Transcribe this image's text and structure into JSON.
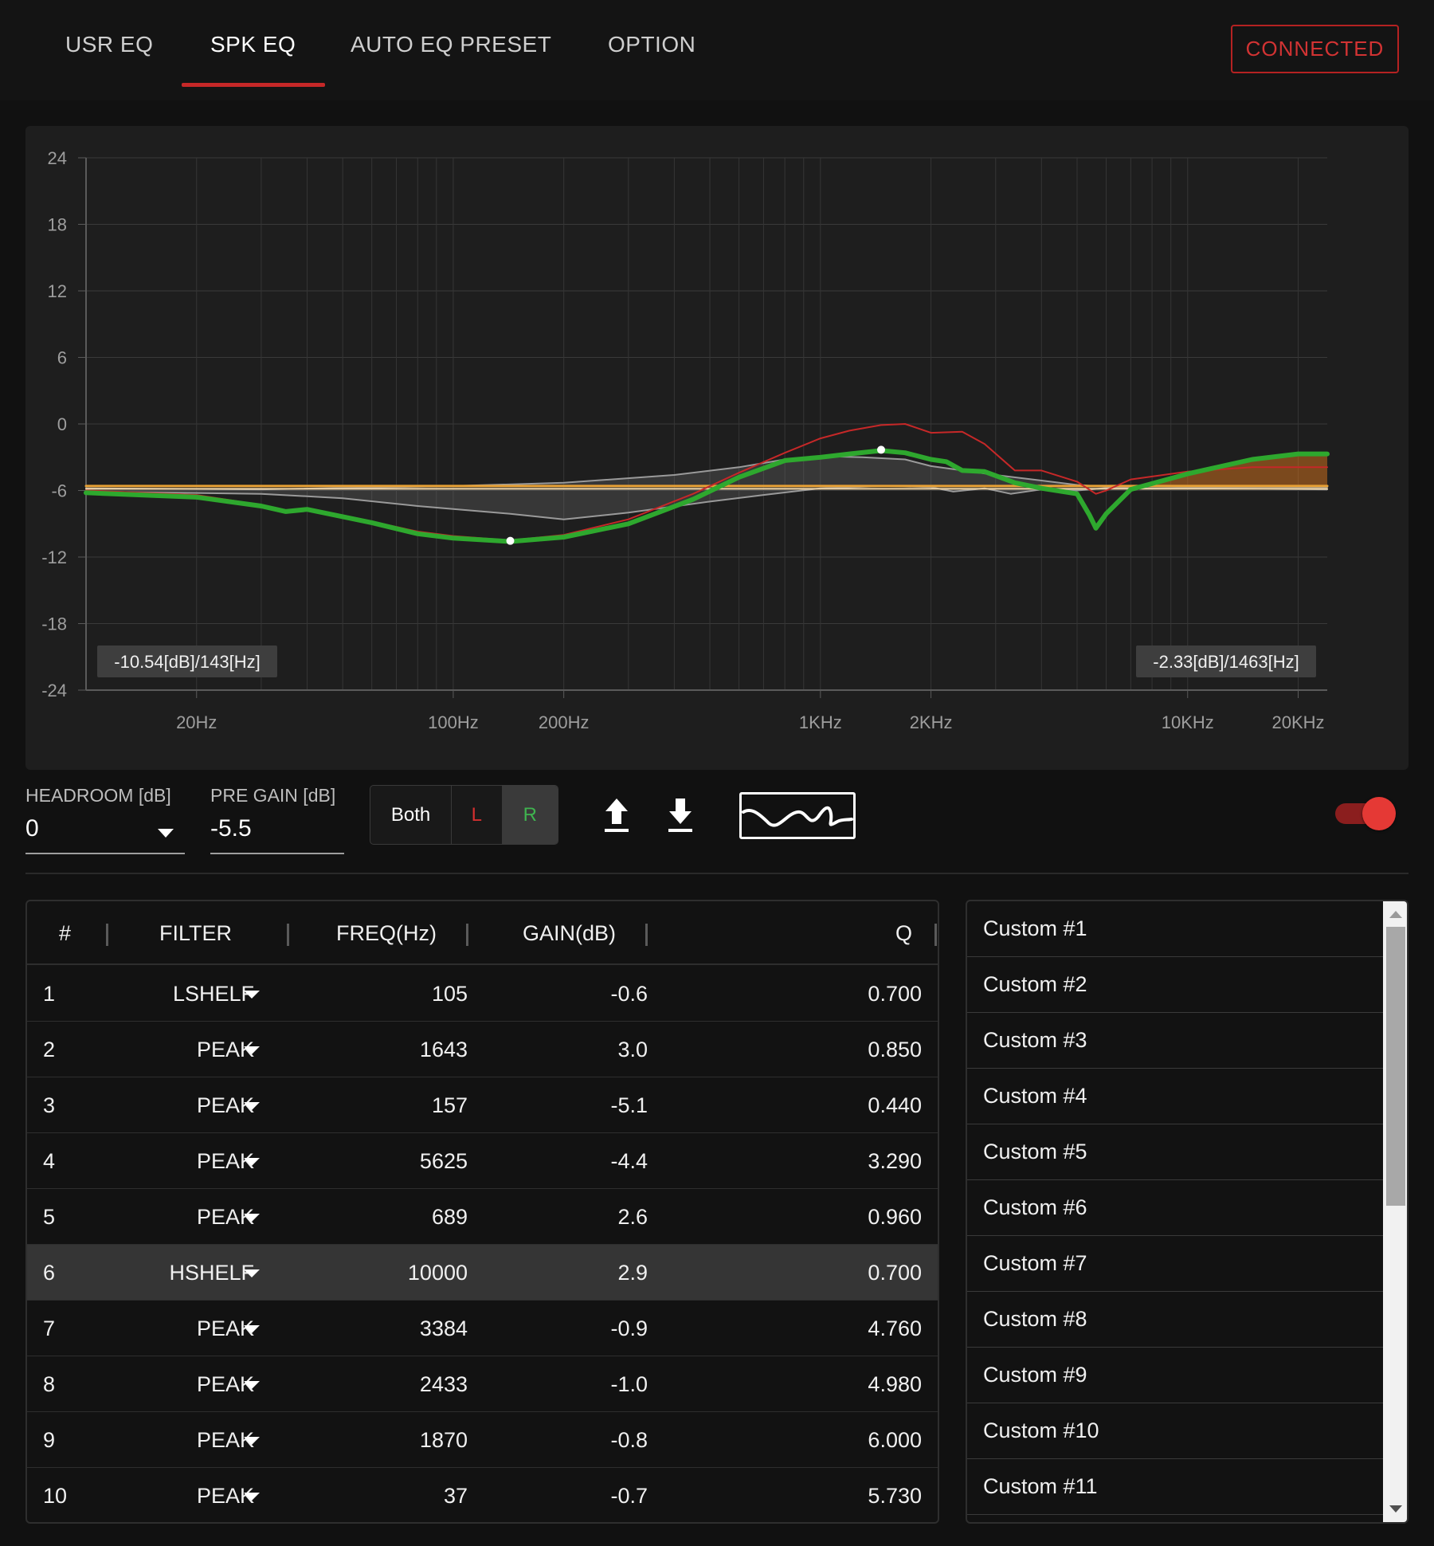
{
  "tabs": [
    {
      "label": "USR EQ",
      "active": false
    },
    {
      "label": "SPK EQ",
      "active": true
    },
    {
      "label": "AUTO EQ PRESET",
      "active": false
    },
    {
      "label": "OPTION",
      "active": false
    }
  ],
  "status": {
    "label": "CONNECTED",
    "color": "#d23333"
  },
  "chart_data": {
    "type": "line",
    "xscale": "log",
    "xlim": [
      10,
      24000
    ],
    "ylim": [
      -24,
      24
    ],
    "y_ticks": [
      "24",
      "18",
      "12",
      "6",
      "0",
      "-6",
      "-12",
      "-18",
      "-24"
    ],
    "x_ticks": [
      {
        "label": "20Hz",
        "value": 20
      },
      {
        "label": "100Hz",
        "value": 100
      },
      {
        "label": "200Hz",
        "value": 200
      },
      {
        "label": "1KHz",
        "value": 1000
      },
      {
        "label": "2KHz",
        "value": 2000
      },
      {
        "label": "10KHz",
        "value": 10000
      },
      {
        "label": "20KHz",
        "value": 20000
      }
    ],
    "grid": true,
    "series": [
      {
        "color": "#2ea82e",
        "points": [
          [
            10,
            -6.2
          ],
          [
            20,
            -6.6
          ],
          [
            30,
            -7.4
          ],
          [
            35,
            -7.9
          ],
          [
            40,
            -7.7
          ],
          [
            60,
            -8.9
          ],
          [
            80,
            -9.9
          ],
          [
            100,
            -10.3
          ],
          [
            143,
            -10.6
          ],
          [
            200,
            -10.2
          ],
          [
            300,
            -9
          ],
          [
            450,
            -6.8
          ],
          [
            600,
            -4.8
          ],
          [
            800,
            -3.3
          ],
          [
            1000,
            -3
          ],
          [
            1200,
            -2.7
          ],
          [
            1463,
            -2.4
          ],
          [
            1700,
            -2.6
          ],
          [
            2000,
            -3.2
          ],
          [
            2200,
            -3.4
          ],
          [
            2433,
            -4.2
          ],
          [
            2800,
            -4.3
          ],
          [
            3384,
            -5.3
          ],
          [
            4000,
            -5.8
          ],
          [
            5000,
            -6.3
          ],
          [
            5400,
            -8.2
          ],
          [
            5625,
            -9.4
          ],
          [
            6000,
            -8.1
          ],
          [
            7000,
            -5.9
          ],
          [
            10000,
            -4.5
          ],
          [
            15000,
            -3.2
          ],
          [
            20000,
            -2.7
          ],
          [
            24000,
            -2.7
          ]
        ]
      },
      {
        "color": "#c62828",
        "points": [
          [
            10,
            -6
          ],
          [
            20,
            -6.4
          ],
          [
            30,
            -7.3
          ],
          [
            35,
            -7.8
          ],
          [
            40,
            -7.6
          ],
          [
            60,
            -8.8
          ],
          [
            80,
            -9.7
          ],
          [
            100,
            -10.1
          ],
          [
            143,
            -10.5
          ],
          [
            200,
            -10
          ],
          [
            300,
            -8.6
          ],
          [
            450,
            -6.3
          ],
          [
            600,
            -4.4
          ],
          [
            800,
            -2.6
          ],
          [
            1000,
            -1.3
          ],
          [
            1200,
            -0.6
          ],
          [
            1463,
            -0.1
          ],
          [
            1700,
            0
          ],
          [
            2000,
            -0.8
          ],
          [
            2433,
            -0.7
          ],
          [
            2800,
            -1.8
          ],
          [
            3384,
            -4.2
          ],
          [
            4000,
            -4.2
          ],
          [
            5000,
            -5.2
          ],
          [
            5625,
            -6.3
          ],
          [
            6000,
            -6
          ],
          [
            7000,
            -5
          ],
          [
            10000,
            -4.3
          ],
          [
            15000,
            -3.9
          ],
          [
            20000,
            -3.9
          ],
          [
            24000,
            -3.9
          ]
        ]
      },
      {
        "color": "#9a9a9a",
        "points": [
          [
            10,
            -5.8
          ],
          [
            30,
            -5.9
          ],
          [
            100,
            -5.6
          ],
          [
            200,
            -5.3
          ],
          [
            400,
            -4.6
          ],
          [
            600,
            -3.9
          ],
          [
            800,
            -3.2
          ],
          [
            1000,
            -2.9
          ],
          [
            1300,
            -3
          ],
          [
            1700,
            -3.2
          ],
          [
            2000,
            -3.8
          ],
          [
            3000,
            -4.6
          ],
          [
            4000,
            -5.1
          ],
          [
            5000,
            -5.5
          ],
          [
            7000,
            -5.8
          ],
          [
            10000,
            -5.8
          ],
          [
            24000,
            -5.9
          ]
        ]
      },
      {
        "color": "#9a9a9a",
        "points": [
          [
            10,
            -6.1
          ],
          [
            30,
            -6.3
          ],
          [
            50,
            -6.7
          ],
          [
            80,
            -7.4
          ],
          [
            143,
            -8.1
          ],
          [
            200,
            -8.6
          ],
          [
            300,
            -8
          ],
          [
            500,
            -7
          ],
          [
            700,
            -6.4
          ],
          [
            1000,
            -5.8
          ],
          [
            1500,
            -5.6
          ],
          [
            2000,
            -5.7
          ],
          [
            2300,
            -6.1
          ],
          [
            2800,
            -5.8
          ],
          [
            3300,
            -6.3
          ],
          [
            4000,
            -5.9
          ],
          [
            5000,
            -6
          ],
          [
            7000,
            -5.6
          ],
          [
            10000,
            -5.7
          ],
          [
            24000,
            -5.7
          ]
        ]
      },
      {
        "color": "#e8a135",
        "points": [
          [
            10,
            -5.6
          ],
          [
            24000,
            -5.6
          ]
        ]
      },
      {
        "color": "#f3d7a8",
        "points": [
          [
            10,
            -5.85
          ],
          [
            24000,
            -5.85
          ]
        ]
      }
    ],
    "markers": [
      [
        143,
        -10.54
      ],
      [
        1463,
        -2.33
      ]
    ],
    "annotations": [
      {
        "text": "-10.54[dB]/143[Hz]",
        "anchor": "bottom-left"
      },
      {
        "text": "-2.33[dB]/1463[Hz]",
        "anchor": "bottom-right"
      }
    ]
  },
  "controls": {
    "headroom_label": "HEADROOM [dB]",
    "headroom_value": "0",
    "pregain_label": "PRE GAIN [dB]",
    "pregain_value": "-5.5",
    "channel_both": "Both",
    "channel_l": "L",
    "channel_r": "R",
    "channel_selected": "R",
    "upload_icon": "upload-icon",
    "download_icon": "download-icon",
    "curve_icon": "curve-icon",
    "toggle_on": true
  },
  "table": {
    "headers": [
      "#",
      "FILTER",
      "FREQ(Hz)",
      "GAIN(dB)",
      "Q"
    ],
    "selected_row": 6,
    "rows": [
      {
        "num": "1",
        "filter": "LSHELF",
        "freq": "105",
        "gain": "-0.6",
        "q": "0.700"
      },
      {
        "num": "2",
        "filter": "PEAK",
        "freq": "1643",
        "gain": "3.0",
        "q": "0.850"
      },
      {
        "num": "3",
        "filter": "PEAK",
        "freq": "157",
        "gain": "-5.1",
        "q": "0.440"
      },
      {
        "num": "4",
        "filter": "PEAK",
        "freq": "5625",
        "gain": "-4.4",
        "q": "3.290"
      },
      {
        "num": "5",
        "filter": "PEAK",
        "freq": "689",
        "gain": "2.6",
        "q": "0.960"
      },
      {
        "num": "6",
        "filter": "HSHELF",
        "freq": "10000",
        "gain": "2.9",
        "q": "0.700"
      },
      {
        "num": "7",
        "filter": "PEAK",
        "freq": "3384",
        "gain": "-0.9",
        "q": "4.760"
      },
      {
        "num": "8",
        "filter": "PEAK",
        "freq": "2433",
        "gain": "-1.0",
        "q": "4.980"
      },
      {
        "num": "9",
        "filter": "PEAK",
        "freq": "1870",
        "gain": "-0.8",
        "q": "6.000"
      },
      {
        "num": "10",
        "filter": "PEAK",
        "freq": "37",
        "gain": "-0.7",
        "q": "5.730"
      }
    ]
  },
  "presets": [
    "Custom #1",
    "Custom #2",
    "Custom #3",
    "Custom #4",
    "Custom #5",
    "Custom #6",
    "Custom #7",
    "Custom #8",
    "Custom #9",
    "Custom #10",
    "Custom #11"
  ]
}
